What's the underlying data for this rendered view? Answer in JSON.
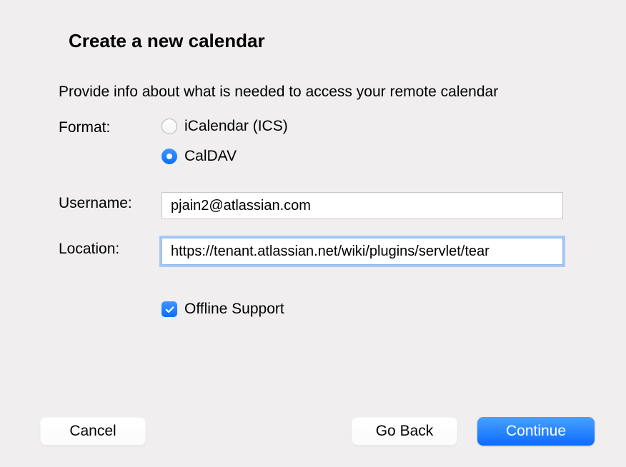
{
  "title": "Create a new calendar",
  "subtitle": "Provide info about what is needed to access your remote calendar",
  "form": {
    "format_label": "Format:",
    "radios": {
      "icalendar": {
        "label": "iCalendar (ICS)",
        "selected": false
      },
      "caldav": {
        "label": "CalDAV",
        "selected": true
      }
    },
    "username_label": "Username:",
    "username_value": "pjain2@atlassian.com",
    "location_label": "Location:",
    "location_value": "https://tenant.atlassian.net/wiki/plugins/servlet/tear",
    "offline_support_label": "Offline Support",
    "offline_support_checked": true
  },
  "buttons": {
    "cancel": "Cancel",
    "go_back": "Go Back",
    "continue": "Continue"
  }
}
